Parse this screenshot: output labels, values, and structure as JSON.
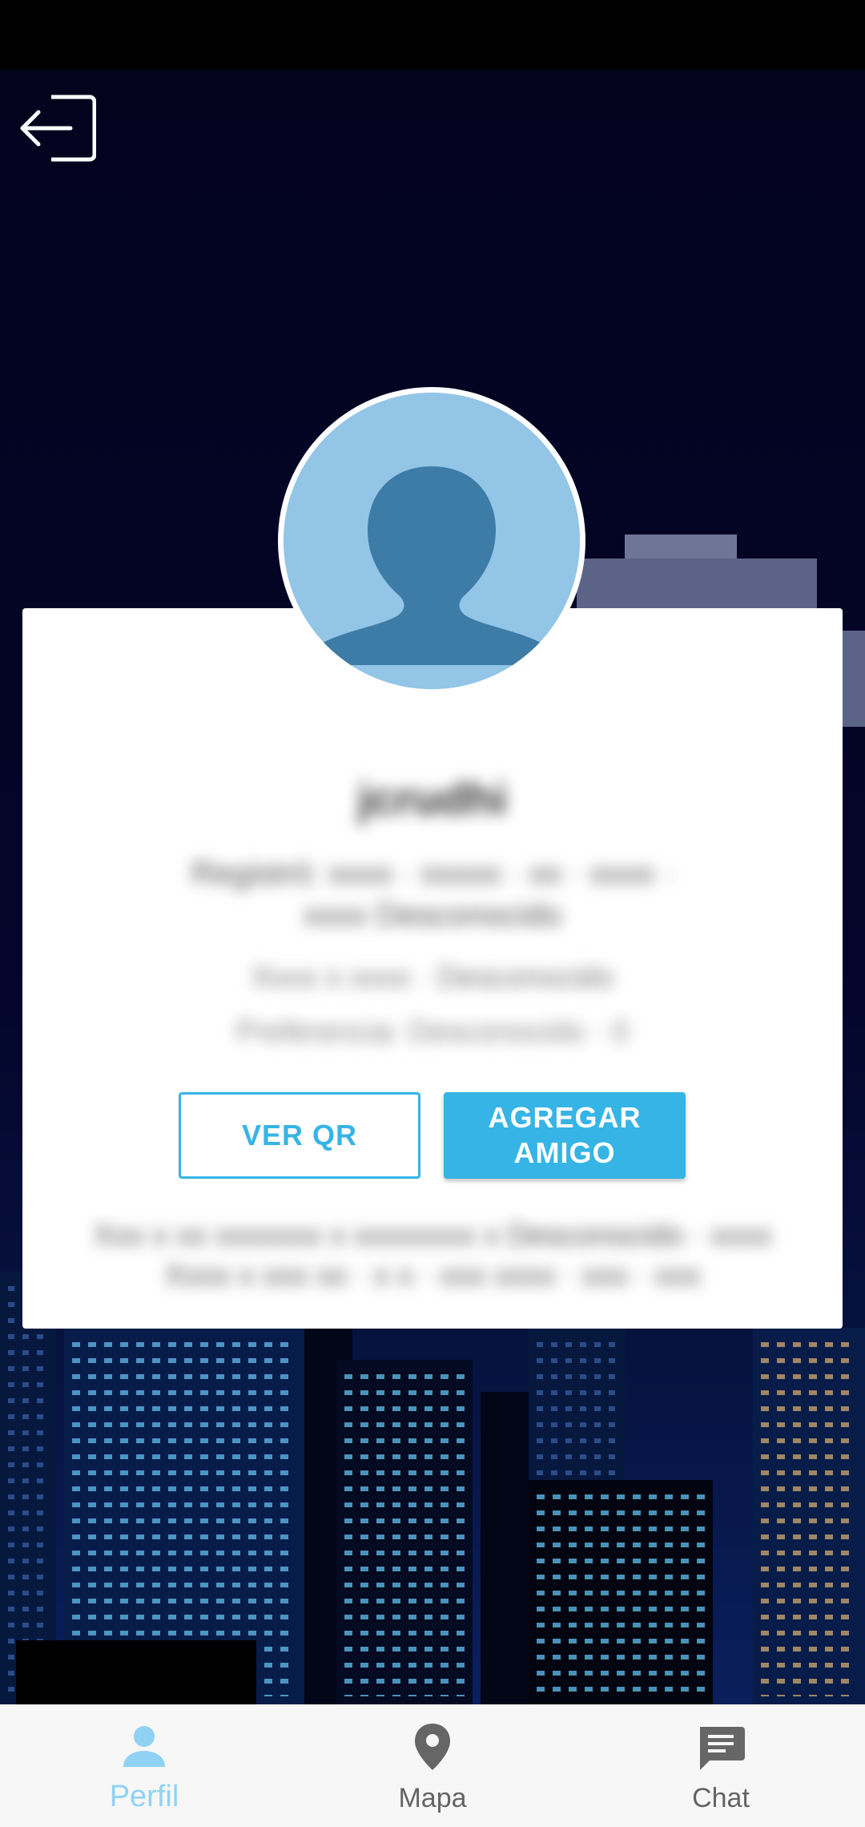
{
  "app": {
    "accent_color": "#36b4e6",
    "active_tab_color": "#8fd2f4"
  },
  "header": {
    "logout_icon": "logout-icon"
  },
  "profile": {
    "avatar_icon": "default-avatar-icon",
    "username": "jcrudhi",
    "bio": "Registró: xxxx · xxxxx · xx · xxxx · xxxx Desconocido",
    "stats": "Xxxx x xxxx · Desconocido",
    "extra": "Preferencia: Desconocido · 0",
    "footer_text": "Xxx x xx xxxxxxx x xxxxxxxx x Desconocido · xxxx Xxxx x xxx xx · x x · xxx xxxx · xxx · xxx"
  },
  "actions": {
    "view_qr_label": "VER QR",
    "add_friend_label": "AGREGAR\nAMIGO"
  },
  "bottom_nav": {
    "items": [
      {
        "label": "Perfil",
        "icon": "person-icon",
        "active": true
      },
      {
        "label": "Mapa",
        "icon": "map-pin-icon",
        "active": false
      },
      {
        "label": "Chat",
        "icon": "chat-icon",
        "active": false
      }
    ]
  }
}
